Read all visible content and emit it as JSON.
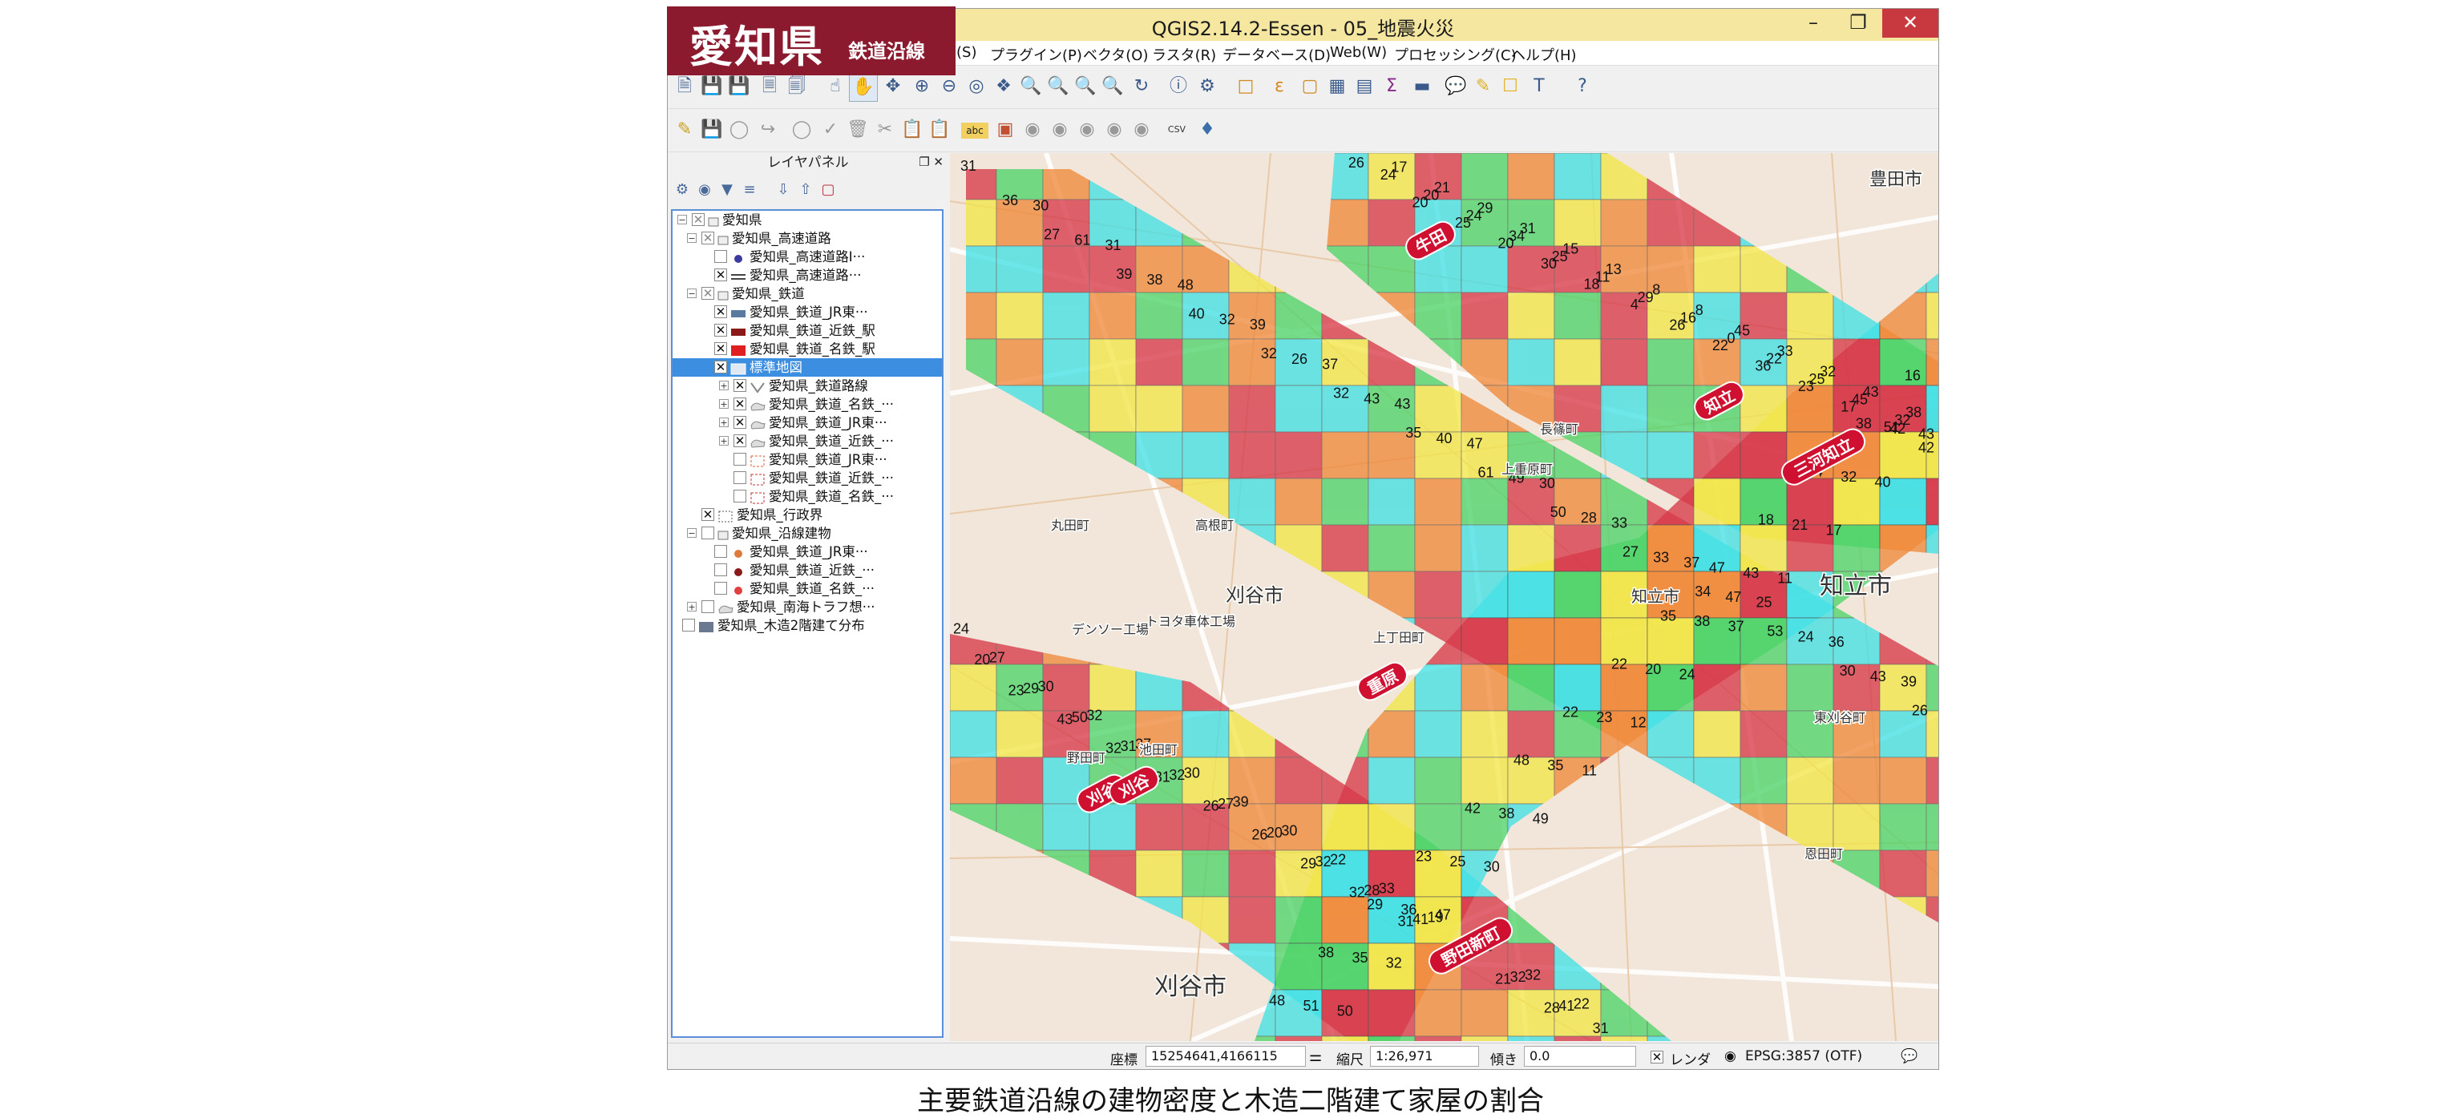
{
  "brand": {
    "main": "愛知県",
    "sub": "鉄道沿線"
  },
  "window": {
    "title": "QGIS2.14.2-Essen - 05_地震火災"
  },
  "menu": [
    "(S)",
    "プラグイン(P)",
    "ベクタ(O)",
    "ラスタ(R)",
    "データベース(D)",
    "Web(W)",
    "プロセッシング(C)",
    "ヘルプ(H)"
  ],
  "layers_panel": {
    "title": "レイヤパネル",
    "items": [
      {
        "label": "愛知県"
      },
      {
        "label": "愛知県_高速道路"
      },
      {
        "label": "愛知県_高速道路I···"
      },
      {
        "label": "愛知県_高速道路···"
      },
      {
        "label": "愛知県_鉄道"
      },
      {
        "label": "愛知県_鉄道_JR東···"
      },
      {
        "label": "愛知県_鉄道_近鉄_駅"
      },
      {
        "label": "愛知県_鉄道_名鉄_駅"
      },
      {
        "label": "標準地図"
      },
      {
        "label": "愛知県_鉄道路線"
      },
      {
        "label": "愛知県_鉄道_名鉄_···"
      },
      {
        "label": "愛知県_鉄道_JR東···"
      },
      {
        "label": "愛知県_鉄道_近鉄_···"
      },
      {
        "label": "愛知県_鉄道_JR東···"
      },
      {
        "label": "愛知県_鉄道_近鉄_···"
      },
      {
        "label": "愛知県_鉄道_名鉄_···"
      },
      {
        "label": "愛知県_行政界"
      },
      {
        "label": "愛知県_沿線建物"
      },
      {
        "label": "愛知県_鉄道_JR東···"
      },
      {
        "label": "愛知県_鉄道_近鉄_···"
      },
      {
        "label": "愛知県_鉄道_名鉄_···"
      },
      {
        "label": "愛知県_南海トラフ想···"
      },
      {
        "label": "愛知県_木造2階建て分布"
      }
    ]
  },
  "map": {
    "places": [
      "豊田市",
      "刈谷市",
      "知立市",
      "知立市",
      "刈谷市",
      "デンソー工場",
      "トヨタ車体工場",
      "長篠町",
      "上重原町",
      "東刈谷町",
      "野田町",
      "恩田町",
      "池田町",
      "上丁田町",
      "高根町",
      "丸田町"
    ],
    "stations": [
      "牛田",
      "知立",
      "三河知立",
      "重原",
      "刈谷",
      "刈谷",
      "野田新町"
    ],
    "numbers": [
      "31",
      "36",
      "27",
      "30",
      "61",
      "39",
      "31",
      "38",
      "40",
      "48",
      "32",
      "32",
      "39",
      "26",
      "32",
      "37",
      "43",
      "35",
      "43",
      "40",
      "61",
      "47",
      "49",
      "50",
      "30",
      "28",
      "27",
      "33",
      "33",
      "34",
      "37",
      "47",
      "53",
      "25",
      "24",
      "30",
      "36",
      "43",
      "26",
      "39",
      "48",
      "51",
      "50",
      "38",
      "35",
      "32",
      "29",
      "36",
      "47",
      "23",
      "25",
      "30",
      "42",
      "38",
      "49",
      "48",
      "35",
      "11",
      "22",
      "23",
      "12",
      "22",
      "20",
      "24",
      "35",
      "38",
      "37",
      "47",
      "43",
      "11",
      "18",
      "21",
      "17",
      "34",
      "32",
      "40",
      "38",
      "42",
      "43",
      "16",
      "24",
      "20",
      "23",
      "27",
      "29",
      "43",
      "30",
      "50",
      "32",
      "32",
      "31",
      "31",
      "37",
      "32",
      "26",
      "30",
      "27",
      "26",
      "39",
      "20",
      "29",
      "30",
      "32",
      "32",
      "22",
      "28",
      "31",
      "33",
      "41",
      "17",
      "19",
      "27",
      "21",
      "31",
      "32",
      "28",
      "32",
      "41",
      "31",
      "22",
      "26",
      "24",
      "20",
      "17",
      "20",
      "25",
      "21",
      "24",
      "20",
      "29",
      "34",
      "30",
      "31",
      "25",
      "18",
      "15",
      "11",
      "4",
      "13",
      "29",
      "26",
      "8",
      "16",
      "22",
      "8",
      "0",
      "36",
      "45",
      "22",
      "23",
      "33",
      "25",
      "17",
      "32",
      "45",
      "51",
      "43",
      "32",
      "42",
      "38"
    ]
  },
  "statusbar": {
    "coords_label": "座標",
    "coords_value": "15254641,4166115",
    "scale_label": "縮尺",
    "scale_value": "1:26,971",
    "rotation_label": "傾き",
    "rotation_value": "0.0",
    "render_label": "レンダ",
    "crs": "EPSG:3857 (OTF)"
  },
  "caption": "主要鉄道沿線の建物密度と木造二階建て家屋の割合",
  "colors": {
    "brand": "#8b1a2e",
    "title_bar": "#f5e7a0",
    "selection": "#3b8ee0",
    "red": "#d83a4a",
    "orange": "#f08a3c",
    "yellow": "#f2e64a",
    "green": "#4fd46a",
    "cyan": "#44e0e4"
  }
}
